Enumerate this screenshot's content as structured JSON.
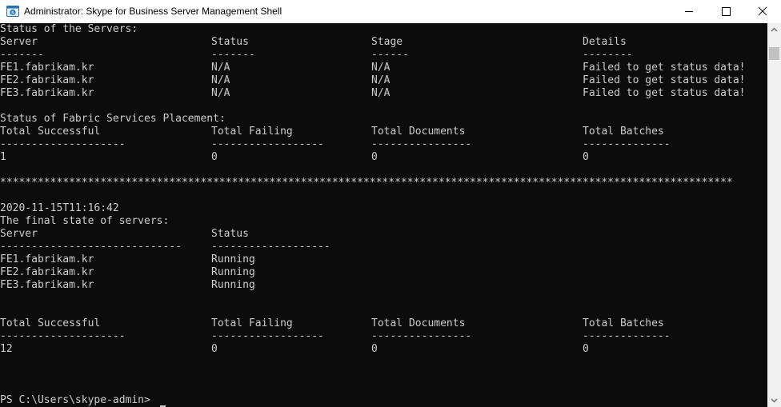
{
  "window": {
    "title": "Administrator: Skype for Business Server Management Shell",
    "icon": "skype-shell-icon"
  },
  "section1": {
    "heading": "Status of the Servers:",
    "headers": [
      "Server",
      "Status",
      "Stage",
      "Details"
    ],
    "dashes": [
      "-------",
      "-------",
      "------",
      "--------"
    ],
    "rows": [
      [
        "FE1.fabrikam.kr",
        "N/A",
        "N/A",
        "Failed to get status data!"
      ],
      [
        "FE2.fabrikam.kr",
        "N/A",
        "N/A",
        "Failed to get status data!"
      ],
      [
        "FE3.fabrikam.kr",
        "N/A",
        "N/A",
        "Failed to get status data!"
      ]
    ]
  },
  "section2": {
    "heading": "Status of Fabric Services Placement:",
    "headers": [
      "Total Successful",
      "Total Failing",
      "Total Documents",
      "Total Batches"
    ],
    "dashes": [
      "--------------------",
      "------------------",
      "----------------",
      "--------------"
    ],
    "values": [
      "1",
      "0",
      "0",
      "0"
    ]
  },
  "separator": "*********************************************************************************************************************",
  "section3": {
    "timestamp": "2020-11-15T11:16:42",
    "heading": "The final state of servers:",
    "headers": [
      "Server",
      "Status"
    ],
    "dashes": [
      "-----------------------------",
      "-------------------"
    ],
    "rows": [
      [
        "FE1.fabrikam.kr",
        "Running"
      ],
      [
        "FE2.fabrikam.kr",
        "Running"
      ],
      [
        "FE3.fabrikam.kr",
        "Running"
      ]
    ]
  },
  "section4": {
    "headers": [
      "Total Successful",
      "Total Failing",
      "Total Documents",
      "Total Batches"
    ],
    "dashes": [
      "--------------------",
      "------------------",
      "----------------",
      "--------------"
    ],
    "values": [
      "12",
      "0",
      "0",
      "0"
    ]
  },
  "prompt": "PS C:\\Users\\skype-admin> ",
  "colors": {
    "console_bg": "#0c0c0c",
    "console_text": "#cccccc",
    "titlebar_bg": "#ffffff"
  }
}
